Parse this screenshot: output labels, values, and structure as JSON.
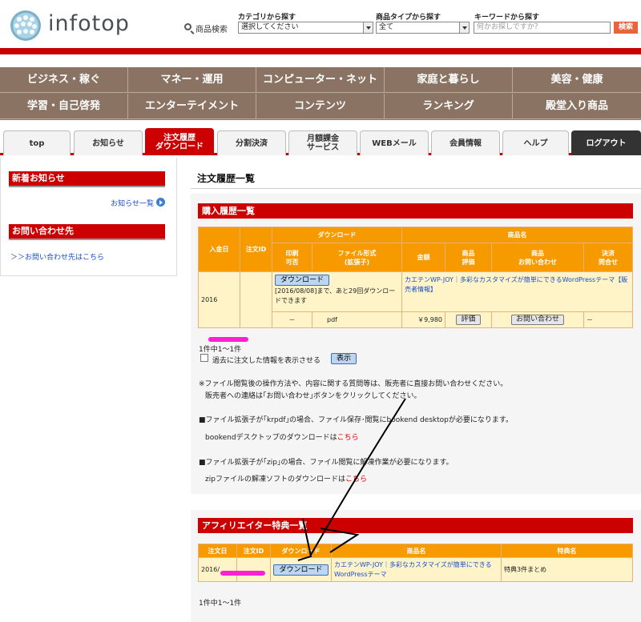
{
  "header": {
    "logo_text": "infotop",
    "search_label": "商品検索",
    "category": {
      "label": "カテゴリから探す",
      "value": "選択してください"
    },
    "type": {
      "label": "商品タイプから探す",
      "value": "全て"
    },
    "keyword": {
      "label": "キーワードから探す",
      "placeholder": "何かお探しですか？"
    },
    "search_button": "検索"
  },
  "nav": {
    "row1": [
      "ビジネス・稼ぐ",
      "マネー・運用",
      "コンピューター・ネット",
      "家庭と暮らし",
      "美容・健康"
    ],
    "row2": [
      "学習・自己啓発",
      "エンターテイメント",
      "コンテンツ",
      "ランキング",
      "殿堂入り商品"
    ]
  },
  "tabs": [
    "top",
    "お知らせ",
    "注文履歴\nダウンロード",
    "分割決済",
    "月額課金\nサービス",
    "WEBメール",
    "会員情報",
    "ヘルプ",
    "ログアウト"
  ],
  "sidebar": {
    "news_title": "新着お知らせ",
    "news_link": "お知らせ一覧",
    "contact_title": "お問い合わせ先",
    "contact_link": "＞＞お問い合わせ先はこちら"
  },
  "main": {
    "title": "注文履歴一覧",
    "purchase": {
      "title": "購入履歴一覧",
      "headers": {
        "date": "入金日",
        "order_id": "注文ID",
        "download": "ダウンロード",
        "product": "商品名",
        "print": "印刷\n可否",
        "format": "ファイル形式\n(拡張子)",
        "price": "金額",
        "rating": "商品\n評価",
        "inquiry": "商品\nお問い合わせ",
        "settle": "決済\n問合せ"
      },
      "row": {
        "date_prefix": "2016",
        "download_button": "ダウンロード",
        "download_note": "[2016/08/08]まで、あと29回ダウンロードできます",
        "product_name": "カエテンWP-JOY｜多彩なカスタマイズが簡単にできるWordPressテーマ",
        "seller_info": "【販売者情報】",
        "print": "－",
        "format": "pdf",
        "price": "￥9,980",
        "rating_button": "評価",
        "inquiry_button": "お問い合わせ",
        "settle": "－"
      },
      "count": "1件中1～1件",
      "past_label": "過去に注文した情報を表示させる",
      "show_button": "表示",
      "notice1": "※ファイル閲覧後の操作方法や、内容に関する質問等は、販売者に直接お問い合わせください。",
      "notice2": "販売者への連絡は｢お問い合わせ｣ボタンをクリックしてください。",
      "krpdf_note": "■ファイル拡張子が｢krpdf｣の場合、ファイル保存･閲覧にbookend desktopが必要になります。",
      "bookend_text": "bookendデスクトップのダウンロードは",
      "zip_note": "■ファイル拡張子が｢zip｣の場合、ファイル閲覧に解凍作業が必要になります。",
      "zip_text": "zipファイルの解凍ソフトのダウンロードは",
      "here_link": "こちら"
    },
    "affiliate": {
      "title": "アフィリエイター特典一覧",
      "headers": {
        "date": "注文日",
        "order_id": "注文ID",
        "download": "ダウンロード",
        "product": "商品名",
        "bonus": "特典名"
      },
      "row": {
        "date_prefix": "2016/",
        "download_button": "ダウンロード",
        "product_name": "カエテンWP-JOY｜多彩なカスタマイズが簡単にできるWordPressテーマ",
        "bonus": "特典3件まとめ"
      },
      "count": "1件中1～1件"
    }
  },
  "colors": {
    "brand_red": "#cc0000",
    "nav_brown": "#8a7363",
    "table_orange": "#f79a00",
    "table_cell": "#fff4c8",
    "scribble": "#ff1fd2"
  }
}
